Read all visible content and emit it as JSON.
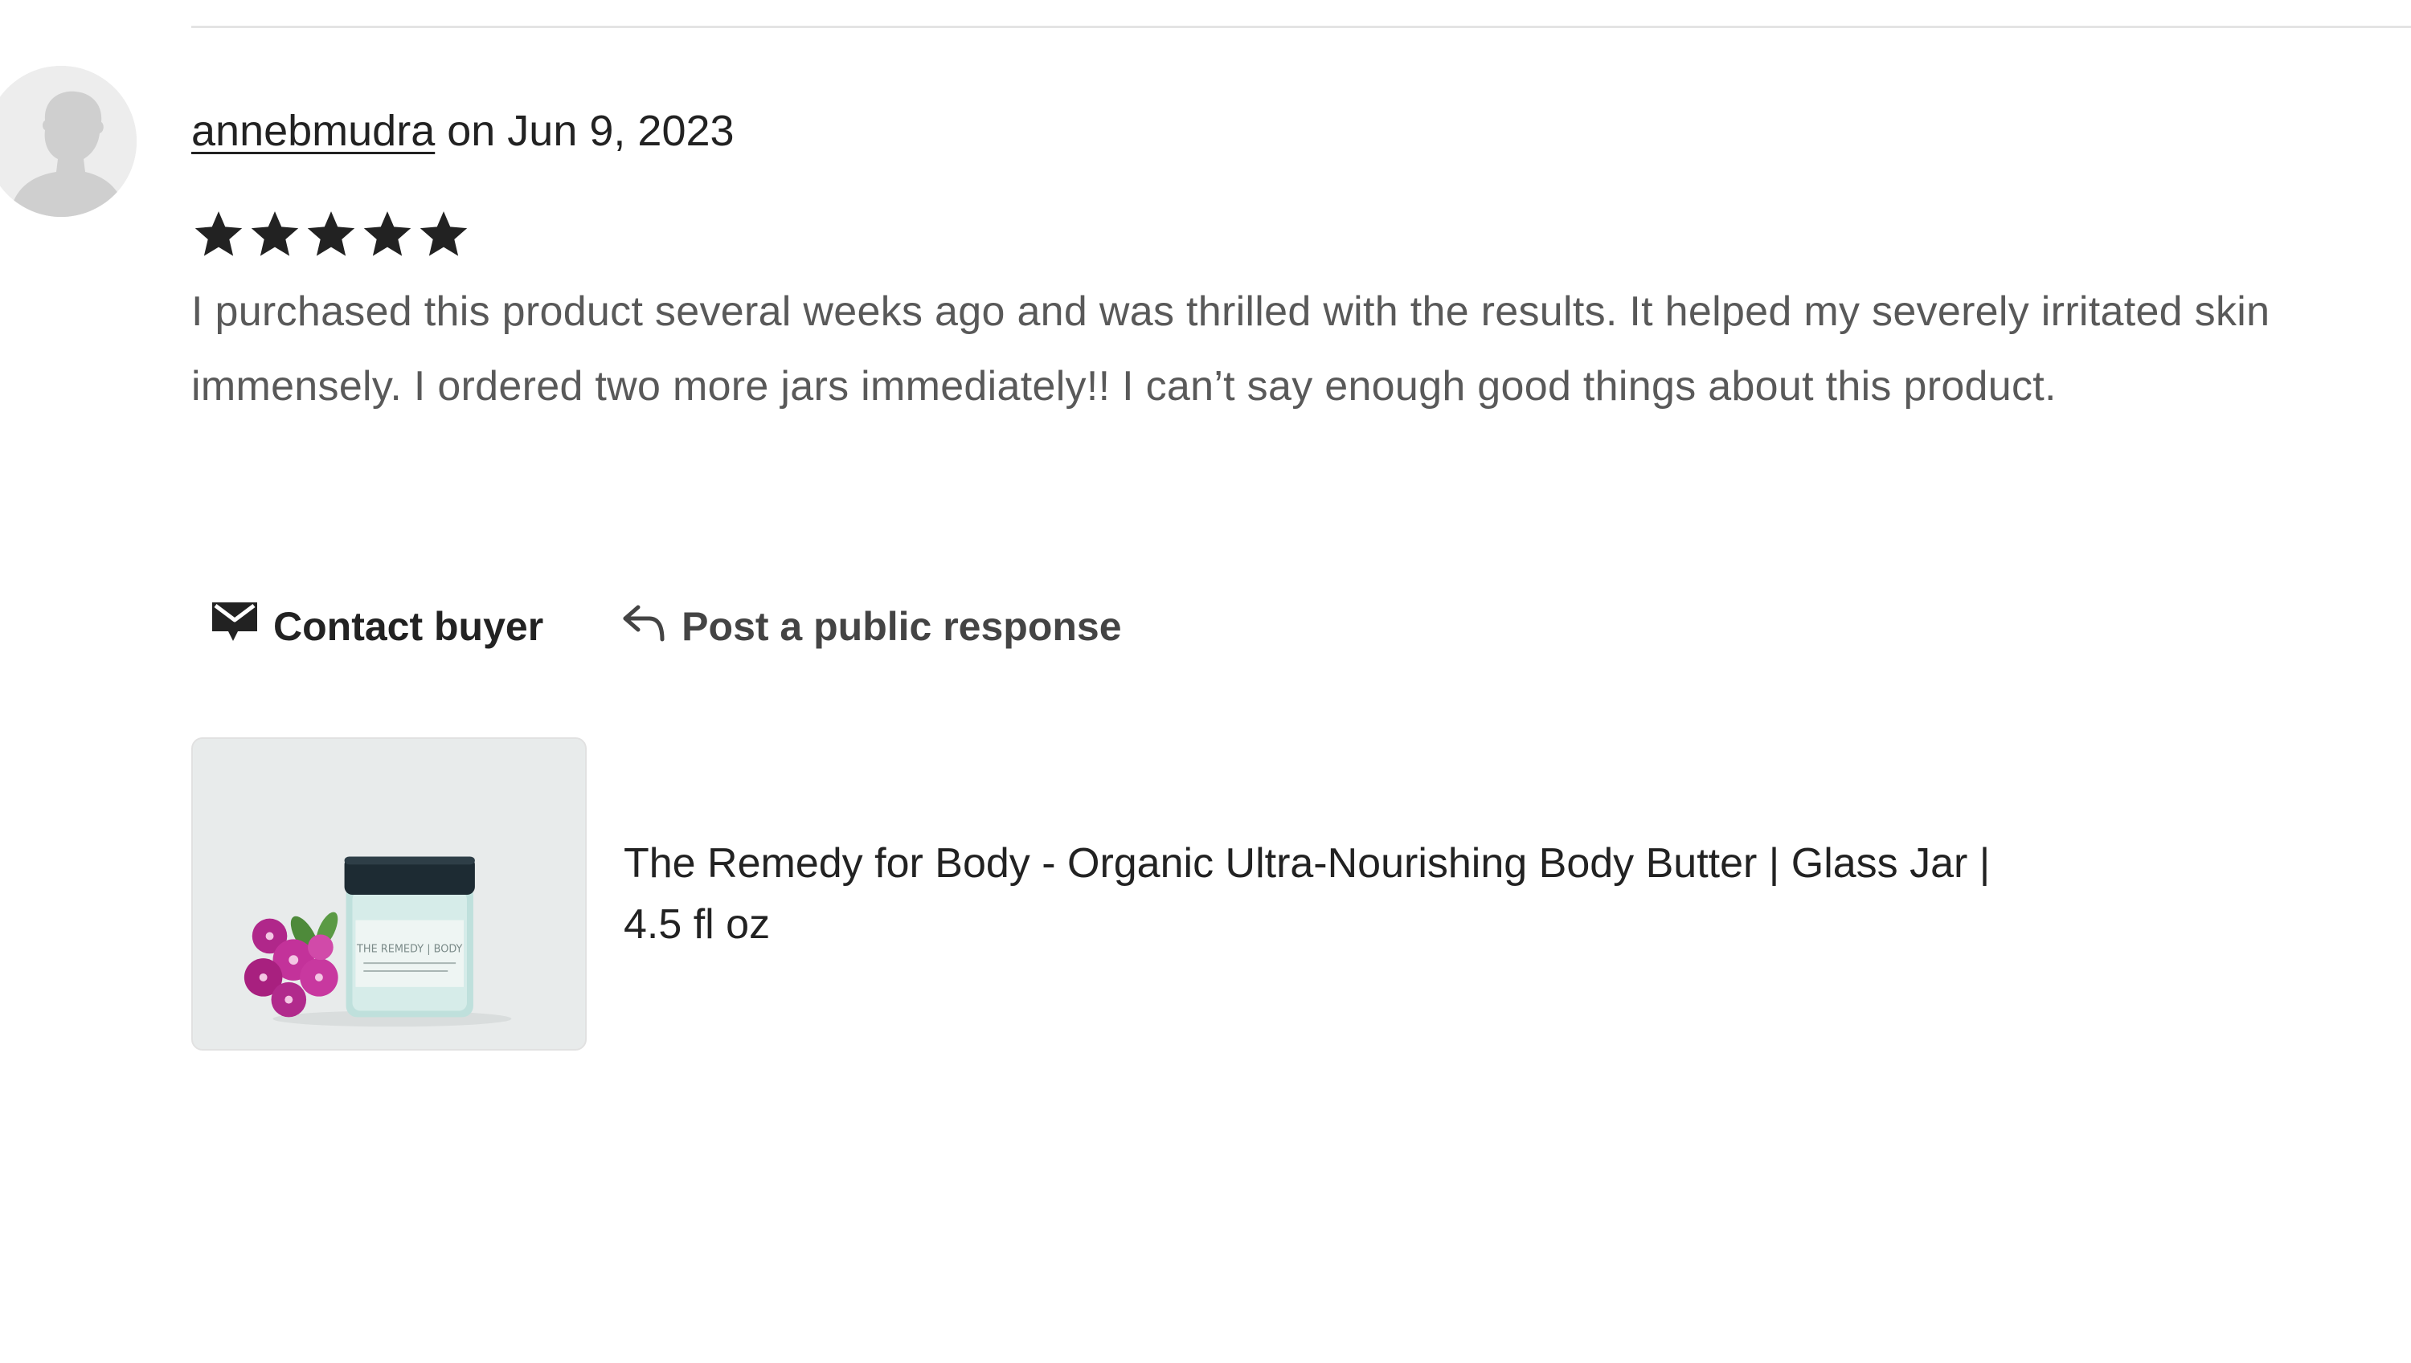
{
  "review": {
    "username": "annebmudra",
    "date_text": " on Jun 9, 2023",
    "rating": 5,
    "rating_max": 5,
    "text": "I purchased this product several weeks ago and was thrilled with the results. It helped my severely irritated skin immensely. I ordered two more jars immediately!! I can’t say enough good things about this product."
  },
  "actions": {
    "contact_label": "Contact buyer",
    "contact_icon": "envelope-icon",
    "respond_label": "Post a public response",
    "respond_icon": "reply-arrow-icon"
  },
  "product": {
    "title": "The Remedy for Body - Organic Ultra-Nourishing Body Butter | Glass Jar | 4.5 fl oz",
    "jar_label": "THE REMEDY | BODY"
  },
  "colors": {
    "text_primary": "#222222",
    "text_secondary": "#595959",
    "star": "#222222",
    "divider": "#e4e4e4"
  }
}
